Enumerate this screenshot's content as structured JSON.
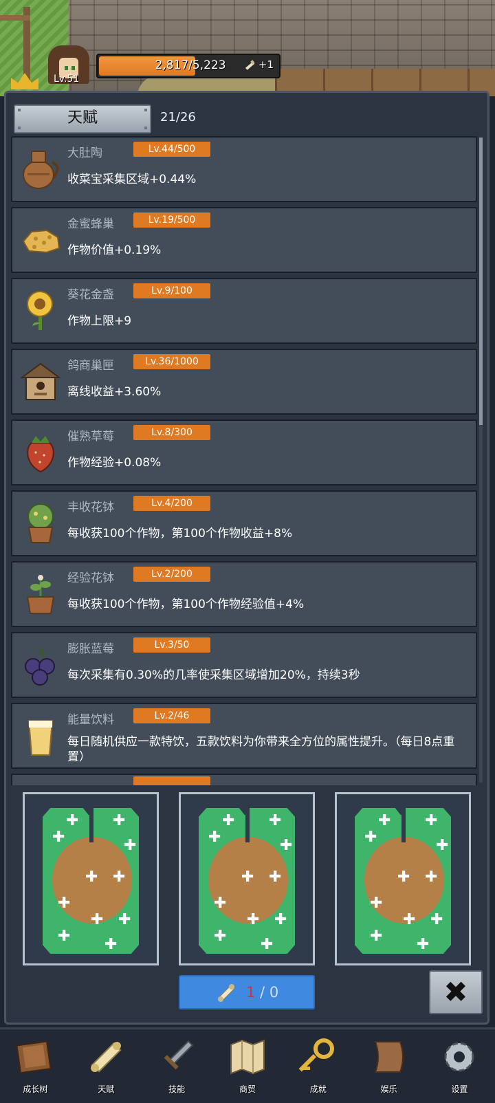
{
  "header": {
    "level": "Lv.51",
    "xp_text": "2,817/5,223",
    "xp_fraction": 0.539,
    "bonus": "+1"
  },
  "panel": {
    "tab_label": "天赋",
    "count": "21/26"
  },
  "talents": [
    {
      "name": "大肚陶",
      "level": "Lv.44/500",
      "desc": "收菜宝采集区域+0.44%",
      "icon": "jug-icon"
    },
    {
      "name": "金蜜蜂巢",
      "level": "Lv.19/500",
      "desc": "作物价值+0.19%",
      "icon": "honeycomb-icon"
    },
    {
      "name": "葵花金盏",
      "level": "Lv.9/100",
      "desc": "作物上限+9",
      "icon": "sunflower-icon"
    },
    {
      "name": "鸽商巢匣",
      "level": "Lv.36/1000",
      "desc": "离线收益+3.60%",
      "icon": "birdhouse-icon"
    },
    {
      "name": "催熟草莓",
      "level": "Lv.8/300",
      "desc": "作物经验+0.08%",
      "icon": "strawberry-icon"
    },
    {
      "name": "丰收花钵",
      "level": "Lv.4/200",
      "desc": "每收获100个作物，第100个作物收益+8%",
      "icon": "flower-pot-icon"
    },
    {
      "name": "经验花钵",
      "level": "Lv.2/200",
      "desc": "每收获100个作物，第100个作物经验值+4%",
      "icon": "sprout-pot-icon"
    },
    {
      "name": "膨胀蓝莓",
      "level": "Lv.3/50",
      "desc": "每次采集有0.30%的几率使采集区域增加20%，持续3秒",
      "icon": "blueberry-icon"
    },
    {
      "name": "能量饮料",
      "level": "Lv.2/46",
      "desc": "每日随机供应一款特饮，五款饮料为你带来全方位的属性提升。（每日8点重置）",
      "icon": "drink-icon"
    }
  ],
  "cards": [
    {
      "icon": "seed-card-icon"
    },
    {
      "icon": "seed-card-icon"
    },
    {
      "icon": "seed-card-icon"
    }
  ],
  "draw_button": {
    "current": "1",
    "separator": " / ",
    "total": "0"
  },
  "close_button": {
    "label": "✖"
  },
  "nav": [
    {
      "label": "成长树",
      "icon": "book-icon"
    },
    {
      "label": "天赋",
      "icon": "scroll-icon"
    },
    {
      "label": "技能",
      "icon": "sword-icon"
    },
    {
      "label": "商贸",
      "icon": "map-icon"
    },
    {
      "label": "成就",
      "icon": "key-icon"
    },
    {
      "label": "娱乐",
      "icon": "banner-icon"
    },
    {
      "label": "设置",
      "icon": "gear-icon"
    }
  ],
  "colors": {
    "accent_orange": "#e07a22",
    "button_blue": "#3f8ae0",
    "panel": "#2c3441",
    "row": "#434c59",
    "seed_green": "#3fb46b"
  }
}
